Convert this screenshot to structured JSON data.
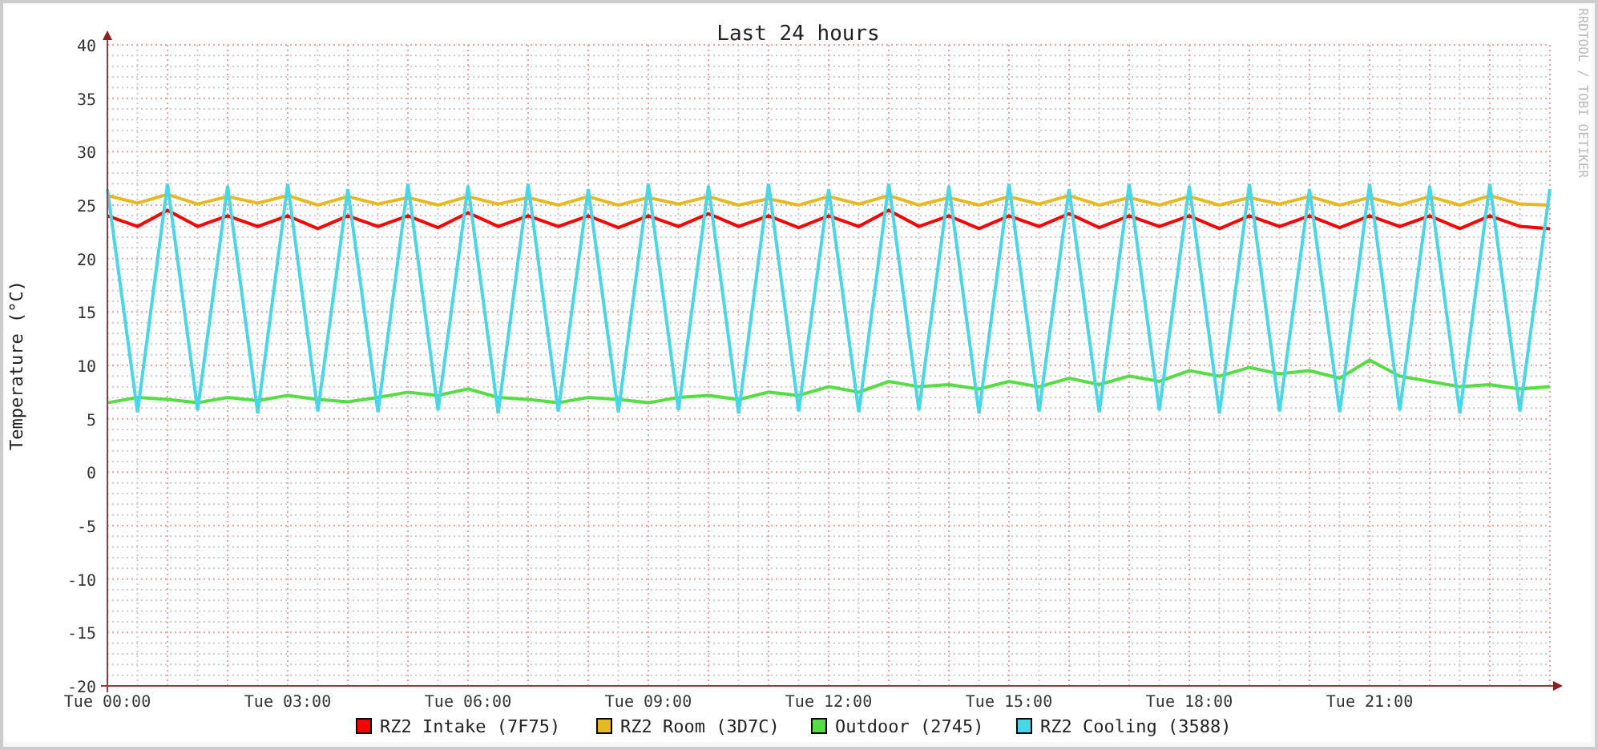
{
  "chart_data": {
    "type": "line",
    "title": "Last 24 hours",
    "ylabel": "Temperature (°C)",
    "categories": [
      "Tue 00:00",
      null,
      null,
      null,
      null,
      null,
      "Tue 03:00",
      null,
      null,
      null,
      null,
      null,
      "Tue 06:00",
      null,
      null,
      null,
      null,
      null,
      "Tue 09:00",
      null,
      null,
      null,
      null,
      null,
      "Tue 12:00",
      null,
      null,
      null,
      null,
      null,
      "Tue 15:00",
      null,
      null,
      null,
      null,
      null,
      "Tue 18:00",
      null,
      null,
      null,
      null,
      null,
      "Tue 21:00",
      null,
      null,
      null,
      null,
      null,
      null
    ],
    "ylim": [
      -20,
      40
    ],
    "grid": true,
    "legend": "bottom",
    "yticks": [
      40,
      35,
      30,
      25,
      20,
      15,
      10,
      5,
      0,
      -5,
      -10,
      -15,
      -20
    ],
    "series": [
      {
        "name": "RZ2 Intake (7F75)",
        "color": "#ff0000",
        "values": [
          24,
          23,
          24.5,
          23,
          24,
          23,
          24,
          22.8,
          24,
          23,
          24,
          22.9,
          24.3,
          23,
          24,
          23,
          24,
          22.9,
          24,
          23,
          24.2,
          23,
          24,
          22.9,
          24,
          23,
          24.5,
          23,
          24,
          22.8,
          24,
          23,
          24.2,
          22.9,
          24,
          23,
          24,
          22.8,
          24,
          23,
          24,
          22.9,
          24,
          23,
          24,
          22.8,
          24,
          23,
          22.8
        ]
      },
      {
        "name": "RZ2 Room (3D7C)",
        "color": "#e6b91e",
        "values": [
          25.9,
          25.2,
          26,
          25.1,
          25.8,
          25.2,
          25.9,
          25,
          25.8,
          25.1,
          25.7,
          25,
          25.8,
          25.1,
          25.7,
          25,
          25.8,
          25,
          25.7,
          25.1,
          25.8,
          25,
          25.6,
          25,
          25.8,
          25.1,
          25.9,
          25,
          25.7,
          25,
          25.8,
          25.1,
          25.9,
          25,
          25.7,
          25,
          25.8,
          25,
          25.7,
          25.1,
          25.8,
          25,
          25.7,
          25,
          25.8,
          25,
          25.9,
          25.1,
          25
        ]
      },
      {
        "name": "Outdoor (2745)",
        "color": "#55dd44",
        "values": [
          6.5,
          7,
          6.8,
          6.5,
          7,
          6.7,
          7.2,
          6.8,
          6.6,
          7,
          7.5,
          7.2,
          7.8,
          7,
          6.8,
          6.5,
          7,
          6.8,
          6.5,
          7,
          7.2,
          6.8,
          7.5,
          7.2,
          8,
          7.5,
          8.5,
          8,
          8.2,
          7.8,
          8.5,
          8,
          8.8,
          8.2,
          9,
          8.5,
          9.5,
          9,
          9.8,
          9.2,
          9.5,
          8.8,
          10.5,
          9,
          8.5,
          8,
          8.2,
          7.8,
          8
        ]
      },
      {
        "name": "RZ2 Cooling (3588)",
        "color": "#44d8e8",
        "values": [
          26.5,
          5.6,
          27,
          5.8,
          26.8,
          5.5,
          27,
          5.7,
          26.5,
          5.6,
          27,
          5.8,
          26.8,
          5.5,
          27,
          5.7,
          26.5,
          5.6,
          27,
          5.8,
          26.8,
          5.5,
          27,
          5.7,
          26.5,
          5.6,
          27,
          5.8,
          26.8,
          5.5,
          27,
          5.7,
          26.5,
          5.6,
          27,
          5.8,
          26.8,
          5.5,
          27,
          5.7,
          26.5,
          5.6,
          27,
          5.8,
          26.8,
          5.5,
          27,
          5.7,
          26.5
        ]
      }
    ]
  },
  "credit": "RRDTOOL / TOBI OETIKER"
}
